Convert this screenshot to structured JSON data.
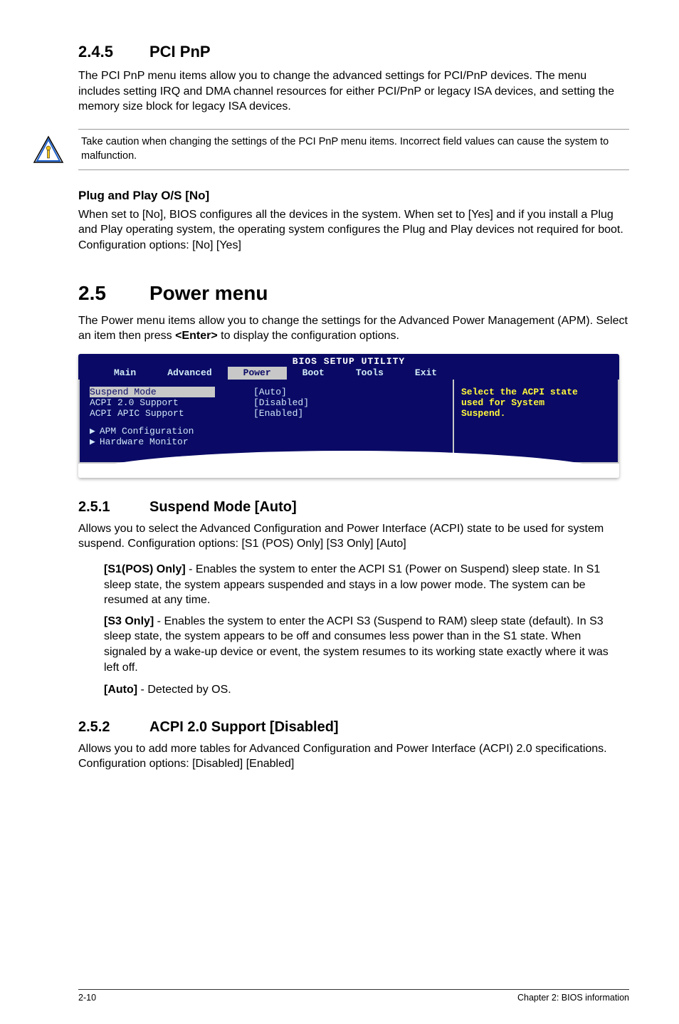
{
  "sec245": {
    "num": "2.4.5",
    "title": "PCI PnP",
    "para": "The PCI PnP menu items allow you to change the advanced settings for PCI/PnP devices. The menu includes setting IRQ and DMA channel resources for either PCI/PnP or legacy ISA devices, and setting the memory size block for legacy ISA devices."
  },
  "callout": {
    "text": "Take caution when changing the settings of the PCI PnP menu items. Incorrect field values can cause the system to malfunction."
  },
  "plug": {
    "title": "Plug and Play O/S [No]",
    "para": "When set to [No], BIOS configures all the devices in the system. When set to [Yes] and if you install a Plug and Play operating system, the operating system configures the Plug and Play devices not required for boot. Configuration options: [No] [Yes]"
  },
  "sec25": {
    "num": "2.5",
    "title": "Power menu",
    "para_pre": "The Power menu items allow you to change the settings for the Advanced Power Management (APM). Select an item then press ",
    "enter": "<Enter>",
    "para_post": " to display the configuration options."
  },
  "bios": {
    "title": "BIOS SETUP UTILITY",
    "tabs": [
      "Main",
      "Advanced",
      "Power",
      "Boot",
      "Tools",
      "Exit"
    ],
    "active_tab_index": 2,
    "rows": [
      {
        "label": "Suspend Mode",
        "value": "[Auto]",
        "selected": true
      },
      {
        "label": "ACPI 2.0 Support",
        "value": "[Disabled]"
      },
      {
        "label": "ACPI APIC Support",
        "value": "[Enabled]"
      }
    ],
    "sub_items": [
      "APM Configuration",
      "Hardware Monitor"
    ],
    "help_lines": [
      "Select the ACPI state",
      "used for System",
      "Suspend."
    ]
  },
  "sec251": {
    "num": "2.5.1",
    "title": "Suspend Mode [Auto]",
    "para": "Allows you to select the Advanced Configuration and Power Interface (ACPI) state to be used for system suspend. Configuration options: [S1 (POS) Only] [S3 Only] [Auto]",
    "s1_label": "[S1(POS) Only]",
    "s1_text": " - Enables the system to enter the ACPI S1 (Power on Suspend) sleep state. In S1 sleep state, the system appears suspended and stays in a low power mode. The system can be resumed at any time.",
    "s3_label": "[S3 Only]",
    "s3_text": " - Enables the system to enter the ACPI S3 (Suspend to RAM) sleep state (default). In S3 sleep state, the system appears to be off and consumes less power than in the S1 state. When signaled by a wake-up device or event, the system resumes to its working state exactly where it was left off.",
    "auto_label": "[Auto]",
    "auto_text": " - Detected by OS."
  },
  "sec252": {
    "num": "2.5.2",
    "title": "ACPI 2.0 Support [Disabled]",
    "para": "Allows you to add more tables for Advanced Configuration and Power Interface (ACPI) 2.0 specifications. Configuration options: [Disabled] [Enabled]"
  },
  "footer": {
    "left": "2-10",
    "right": "Chapter 2: BIOS information"
  }
}
